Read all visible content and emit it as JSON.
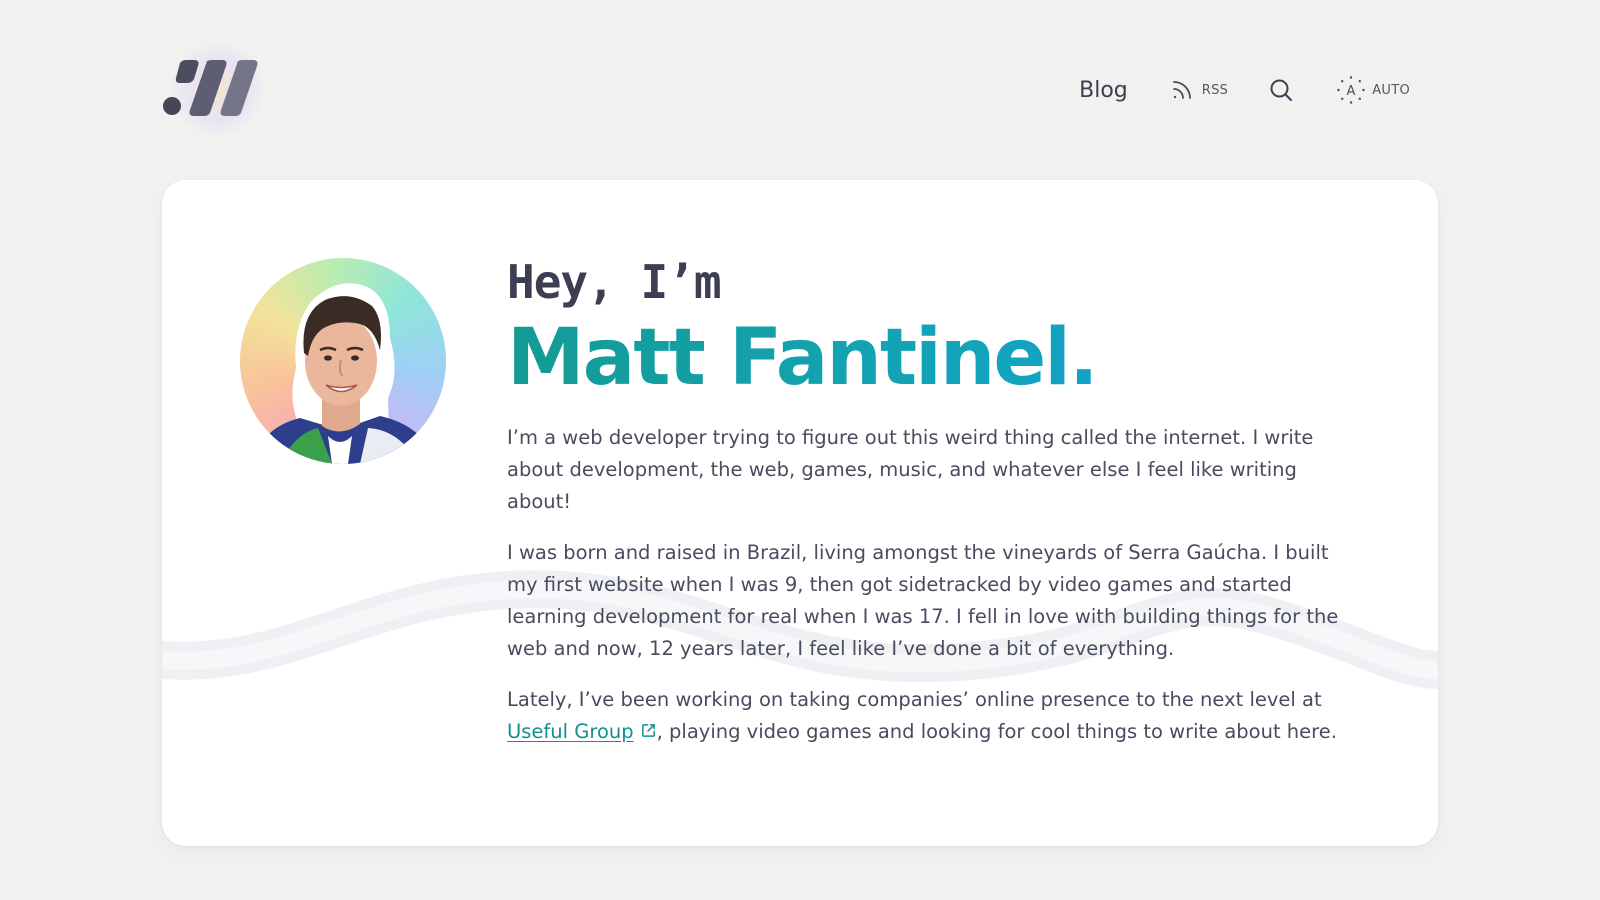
{
  "header": {
    "nav": {
      "blog_label": "Blog",
      "rss_label": "RSS",
      "search_icon": "search-icon",
      "theme_label": "AUTO"
    },
    "logo_icon": "site-logo-slashes"
  },
  "hero": {
    "greeting": "Hey, I’m",
    "name": "Matt Fantinel.",
    "paragraphs": [
      "I’m a web developer trying to figure out this weird thing called the internet. I write about development, the web, games, music, and whatever else I feel like writing about!",
      "I was born and raised in Brazil, living amongst the vineyards of Serra Gaúcha. I built my first website when I was 9, then got sidetracked by video games and started learning development for real when I was 17. I fell in love with building things for the web and now, 12 years later, I feel like I’ve done a bit of everything."
    ],
    "para3": {
      "before_link": "Lately, I’ve been working on taking companies’ online presence to the next level at ",
      "link_text": "Useful Group",
      "after_link": ", playing video games and looking for cool things to write about here."
    }
  },
  "colors": {
    "background": "#f2f1ef",
    "card": "#ffffff",
    "text": "#3d3e52",
    "accent_start": "#139b93",
    "accent_end": "#13a3d8",
    "link": "#13908d"
  }
}
